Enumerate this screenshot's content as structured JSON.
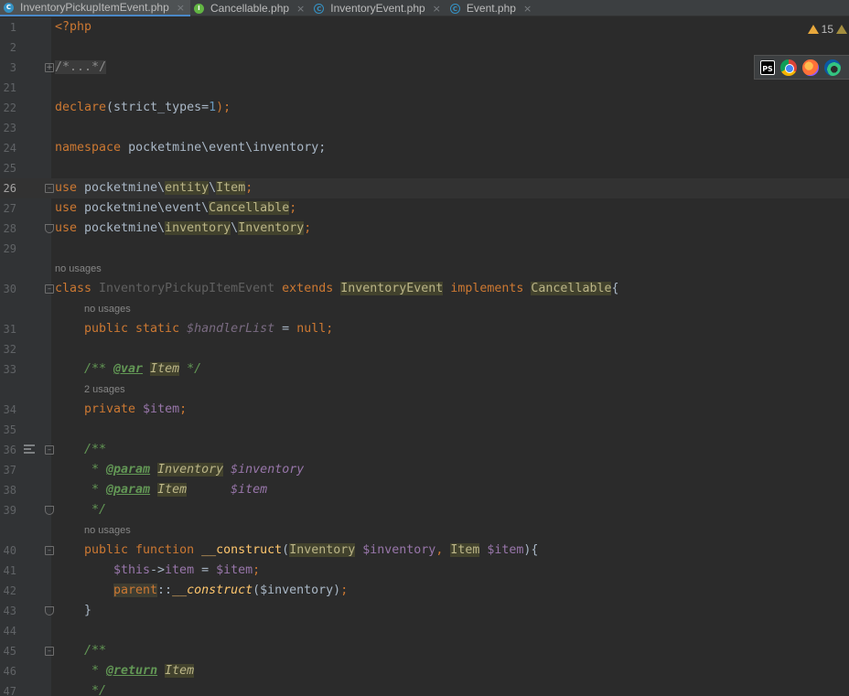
{
  "tabs": [
    {
      "label": "InventoryPickupItemEvent.php",
      "kind": "class",
      "active": true
    },
    {
      "label": "Cancellable.php",
      "kind": "interface",
      "active": false
    },
    {
      "label": "InventoryEvent.php",
      "kind": "abstract-class",
      "active": false
    },
    {
      "label": "Event.php",
      "kind": "abstract-class",
      "active": false
    }
  ],
  "icons": {
    "tab_class": "C",
    "tab_interface": "I",
    "tab_abstract": "C",
    "close": "×",
    "phpstorm": "PS"
  },
  "inspection": {
    "warnings": "15"
  },
  "browsers": [
    "phpstorm-icon",
    "chrome-icon",
    "firefox-icon",
    "edge-icon"
  ],
  "line_numbers": [
    "1",
    "2",
    "3",
    "21",
    "22",
    "23",
    "24",
    "25",
    "26",
    "27",
    "28",
    "29",
    "30",
    "31",
    "32",
    "33",
    "34",
    "35",
    "36",
    "37",
    "38",
    "39",
    "40",
    "41",
    "42",
    "43",
    "44",
    "45",
    "46",
    "47"
  ],
  "hints": {
    "class_usages": "no usages",
    "handler_usages": "no usages",
    "item_usages": "2 usages",
    "ctor_usages": "no usages"
  },
  "code": {
    "open_tag": "<?php",
    "folded_comment": "/*...*/",
    "declare": "declare",
    "strict": "(strict_types=",
    "strict_val": "1",
    "strict_end": ");",
    "namespace_kw": "namespace",
    "namespace_name": " pocketmine\\event\\inventory;",
    "use": "use",
    "use1_pre": " pocketmine\\",
    "use1_mid": "entity",
    "use1_sep": "\\",
    "use1_end": "Item",
    "semicolon": ";",
    "use2_pre": " pocketmine\\event\\",
    "use2_end": "Cancellable",
    "use3_pre": " pocketmine\\",
    "use3_mid": "inventory",
    "use3_sep": "\\",
    "use3_end": "Inventory",
    "class_kw": "class",
    "class_name": " InventoryPickupItemEvent ",
    "extends_kw": "extends",
    "parent_class": "InventoryEvent",
    "implements_kw": "implements",
    "iface": "Cancellable",
    "brace_open": "{",
    "public_static": "public static",
    "handler_var": "$handlerList",
    "eq_null_eq": " = ",
    "null_kw": "null",
    "doc_var_open": "/** ",
    "doc_var_tag": "@var",
    "doc_var_type": "Item",
    "doc_var_close": " */",
    "private_kw": "private",
    "item_var": " $item",
    "doc_open": "/**",
    "doc_star": " * ",
    "param_tag": "@param",
    "param1_type": "Inventory",
    "param1_var": " $inventory",
    "param2_type": "Item",
    "param2_var": "      $item",
    "doc_close": " */",
    "public_function": "public function",
    "construct": " __construct",
    "lparen": "(",
    "arg1_type": "Inventory",
    "arg1_var": " $inventory",
    "comma": ", ",
    "arg2_type": "Item",
    "arg2_var": " $item",
    "rparen_brace": "){",
    "this": "$this",
    "arrow": "->",
    "item_field": "item",
    "assign": " = ",
    "item_val": "$item",
    "parent_kw": "parent",
    "dcolon": "::",
    "parent_construct": "__construct",
    "parent_args": "($inventory)",
    "close_brace": "}",
    "return_tag": "@return",
    "return_type": "Item",
    "doc_end": " */"
  }
}
